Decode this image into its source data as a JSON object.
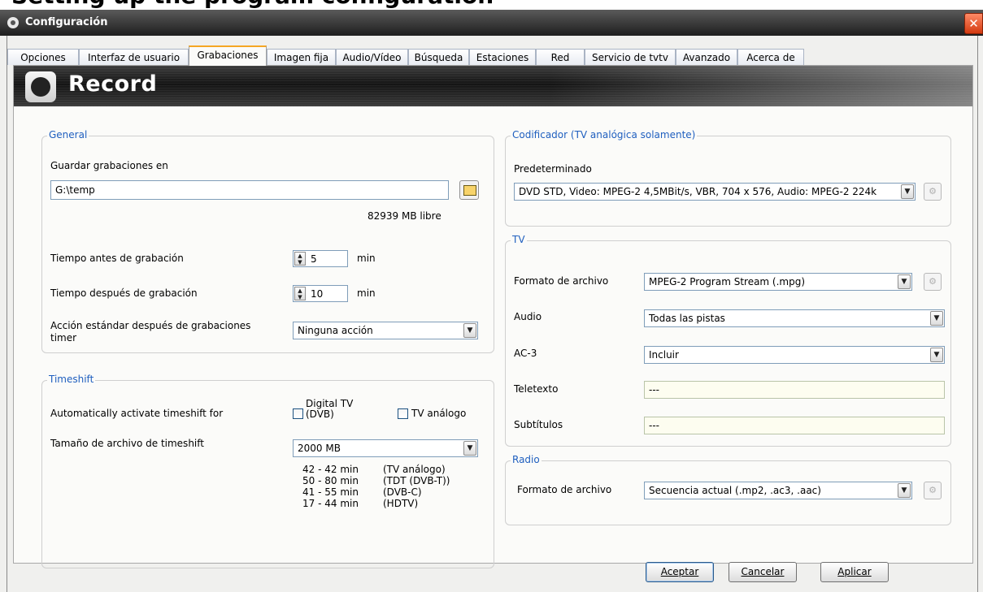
{
  "page_heading": "Setting up the program configuration",
  "window": {
    "title": "Configuración",
    "close_glyph": "✕"
  },
  "tabs": [
    {
      "label": "Opciones"
    },
    {
      "label": "Interfaz de usuario"
    },
    {
      "label": "Grabaciones",
      "active": true
    },
    {
      "label": "Imagen fija"
    },
    {
      "label": "Audio/Vídeo"
    },
    {
      "label": "Búsqueda"
    },
    {
      "label": "Estaciones"
    },
    {
      "label": "Red"
    },
    {
      "label": "Servicio de tvtv"
    },
    {
      "label": "Avanzado"
    },
    {
      "label": "Acerca de"
    }
  ],
  "banner": {
    "title": "Record"
  },
  "general": {
    "legend": "General",
    "save_label": "Guardar grabaciones en",
    "save_path": "G:\\temp",
    "free_space": "82939 MB libre",
    "pre_time_label": "Tiempo antes de grabación",
    "pre_time_value": "5",
    "post_time_label": "Tiempo después de grabación",
    "post_time_value": "10",
    "unit": "min",
    "action_label": "Acción estándar después de grabaciones timer",
    "action_value": "Ninguna acción"
  },
  "timeshift": {
    "legend": "Timeshift",
    "auto_label": "Automatically activate timeshift for",
    "digital_label": "Digital TV (DVB)",
    "digital_checked": false,
    "analog_label": "TV análogo",
    "analog_checked": false,
    "size_label": "Tamaño de archivo de timeshift",
    "size_value": "2000 MB",
    "estimates": [
      {
        "range": "42 -  42 min",
        "type": "(TV análogo)"
      },
      {
        "range": "50 -  80 min",
        "type": "(TDT (DVB-T))"
      },
      {
        "range": "41 -  55 min",
        "type": "(DVB-C)"
      },
      {
        "range": "17 -  44 min",
        "type": "(HDTV)"
      }
    ]
  },
  "encoder": {
    "legend": "Codificador (TV analógica solamente)",
    "default_label": "Predeterminado",
    "default_value": "DVD STD, Video: MPEG-2 4,5MBit/s, VBR, 704 x 576, Audio: MPEG-2 224k"
  },
  "tv": {
    "legend": "TV",
    "format_label": "Formato de archivo",
    "format_value": "MPEG-2 Program Stream (.mpg)",
    "audio_label": "Audio",
    "audio_value": "Todas las pistas",
    "ac3_label": "AC-3",
    "ac3_value": "Incluir",
    "teletext_label": "Teletexto",
    "teletext_value": "---",
    "subtitles_label": "Subtítulos",
    "subtitles_value": "---"
  },
  "radio": {
    "legend": "Radio",
    "format_label": "Formato de archivo",
    "format_value": "Secuencia actual (.mp2, .ac3, .aac)"
  },
  "buttons": {
    "ok": "Aceptar",
    "cancel": "Cancelar",
    "apply": "Aplicar"
  },
  "icons": {
    "dropdown": "▼",
    "spin_up": "▲",
    "spin_down": "▼",
    "config": "⚙"
  }
}
